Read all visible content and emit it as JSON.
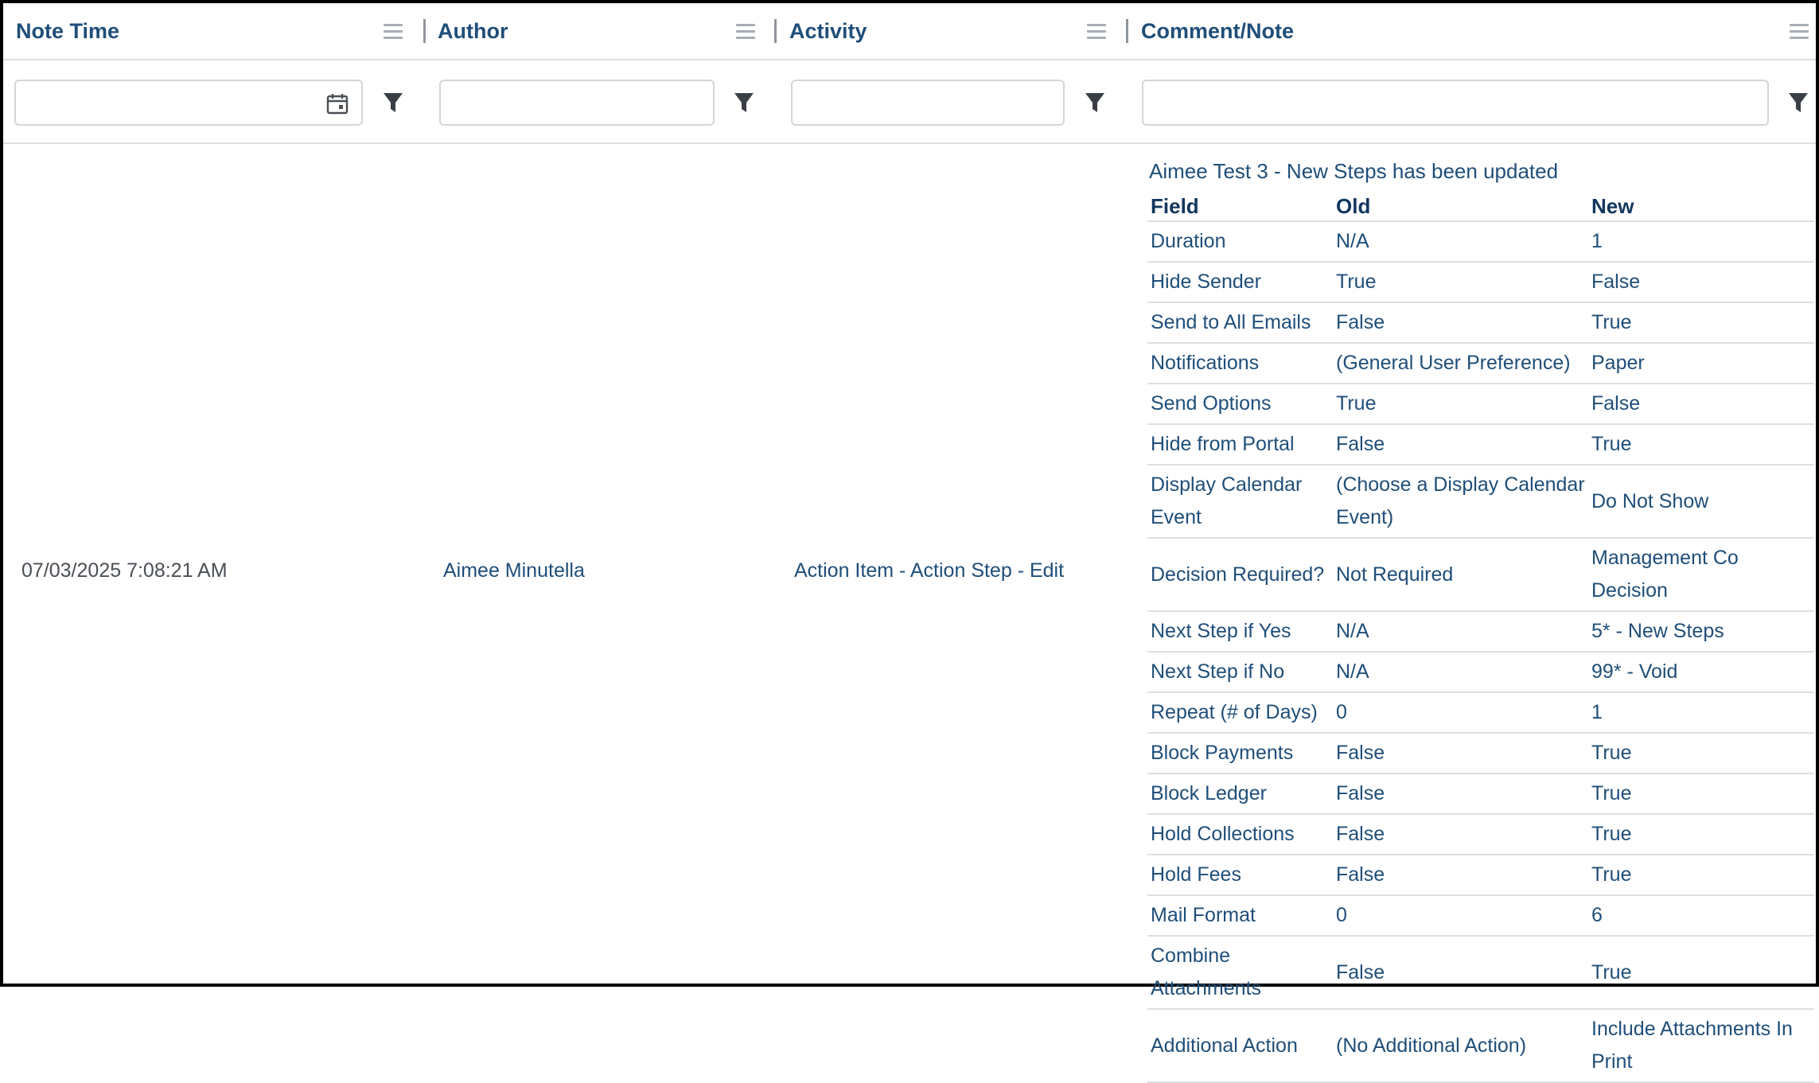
{
  "header": {
    "columns": [
      "Note Time",
      "Author",
      "Activity",
      "Comment/Note"
    ]
  },
  "row": {
    "note_time": "07/03/2025 7:08:21 AM",
    "author": "Aimee Minutella",
    "activity": "Action Item - Action Step - Edit",
    "comment_title": "Aimee Test 3 - New Steps has been updated",
    "table_headers": [
      "Field",
      "Old",
      "New"
    ],
    "changes": [
      [
        "Duration",
        "N/A",
        "1"
      ],
      [
        "Hide Sender",
        "True",
        "False"
      ],
      [
        "Send to All Emails",
        "False",
        "True"
      ],
      [
        "Notifications",
        "(General User Preference)",
        "Paper"
      ],
      [
        "Send Options",
        "True",
        "False"
      ],
      [
        "Hide from Portal",
        "False",
        "True"
      ],
      [
        "Display Calendar Event",
        "(Choose a Display Calendar Event)",
        "Do Not Show"
      ],
      [
        "Decision Required?",
        "Not Required",
        "Management Co Decision"
      ],
      [
        "Next Step if Yes",
        "N/A",
        "5* - New Steps"
      ],
      [
        "Next Step if No",
        "N/A",
        "99* - Void"
      ],
      [
        "Repeat (# of Days)",
        "0",
        "1"
      ],
      [
        "Block Payments",
        "False",
        "True"
      ],
      [
        "Block Ledger",
        "False",
        "True"
      ],
      [
        "Hold Collections",
        "False",
        "True"
      ],
      [
        "Hold Fees",
        "False",
        "True"
      ],
      [
        "Mail Format",
        "0",
        "6"
      ],
      [
        "Combine Attachments",
        "False",
        "True"
      ],
      [
        "Additional Action",
        "(No Additional Action)",
        "Include Attachments In Print"
      ]
    ]
  },
  "icons": {
    "menu": "hamburger-menu-icon",
    "calendar": "calendar-icon",
    "filter": "filter-funnel-icon"
  },
  "colors": {
    "header_text": "#1f4e79",
    "body_text": "#1f4e79",
    "time_text": "#4a4f55",
    "border": "#dcdfe3"
  }
}
